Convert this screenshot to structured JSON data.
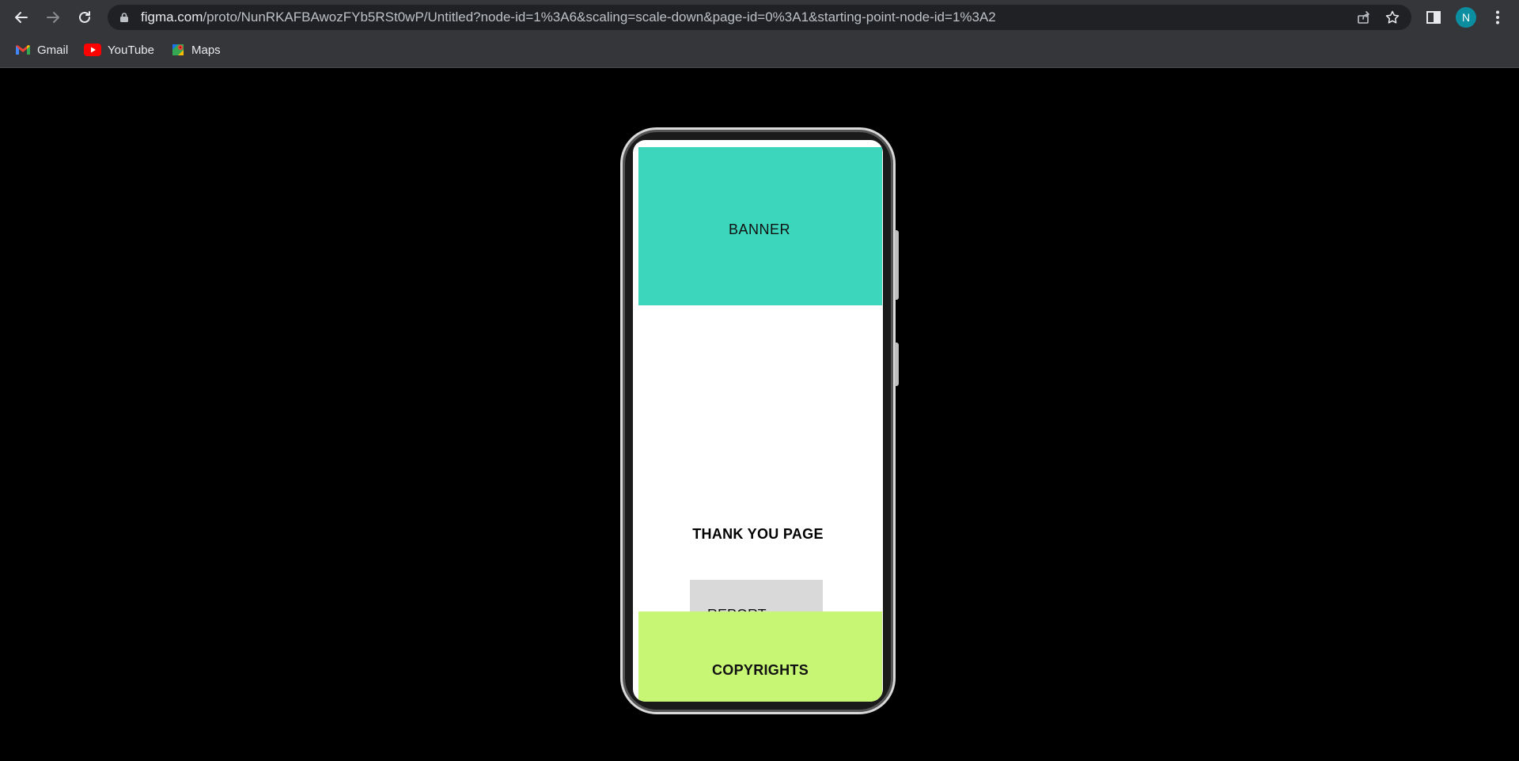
{
  "browser": {
    "url_host": "figma.com",
    "url_path": "/proto/NunRKAFBAwozFYb5RSt0wP/Untitled?node-id=1%3A6&scaling=scale-down&page-id=0%3A1&starting-point-node-id=1%3A2",
    "profile_initial": "N",
    "icons": [
      "back-icon",
      "forward-icon",
      "reload-icon",
      "lock-icon",
      "share-icon",
      "star-icon",
      "side-panel-icon",
      "menu-icon"
    ],
    "bookmarks": [
      {
        "label": "Gmail",
        "icon": "gmail-icon"
      },
      {
        "label": "YouTube",
        "icon": "youtube-icon"
      },
      {
        "label": "Maps",
        "icon": "maps-icon"
      }
    ]
  },
  "prototype": {
    "banner_label": "BANNER",
    "thankyou_label": "THANK YOU PAGE",
    "report_label": "REPORT",
    "copyright_label": "COPYRIGHTS"
  },
  "colors": {
    "banner": "#3bd6bc",
    "footer": "#c7f574",
    "report_button": "#d9d9d9",
    "background": "#000000",
    "chrome": "#35363a"
  }
}
